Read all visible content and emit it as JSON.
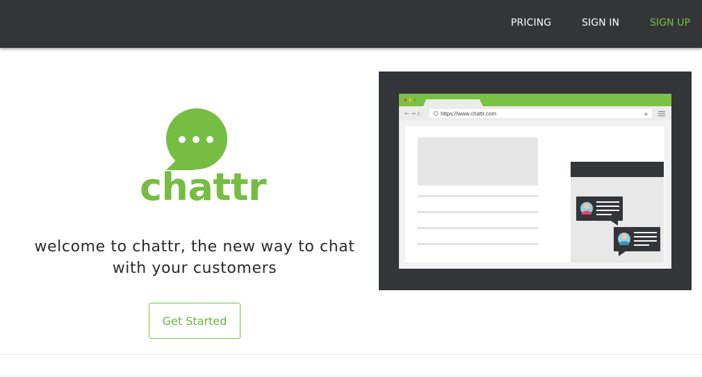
{
  "nav": {
    "pricing": "PRICING",
    "sign_in": "SIGN IN",
    "sign_up": "SIGN UP"
  },
  "brand": {
    "name": "chattr",
    "color": "#76bd43"
  },
  "hero": {
    "tagline_line1": "welcome to chattr, the new way to chat",
    "tagline_line2": "with your customers",
    "cta_label": "Get Started"
  },
  "illustration": {
    "url": "https://www.chattr.com"
  },
  "colors": {
    "topbar": "#333538",
    "accent": "#7bc143"
  }
}
